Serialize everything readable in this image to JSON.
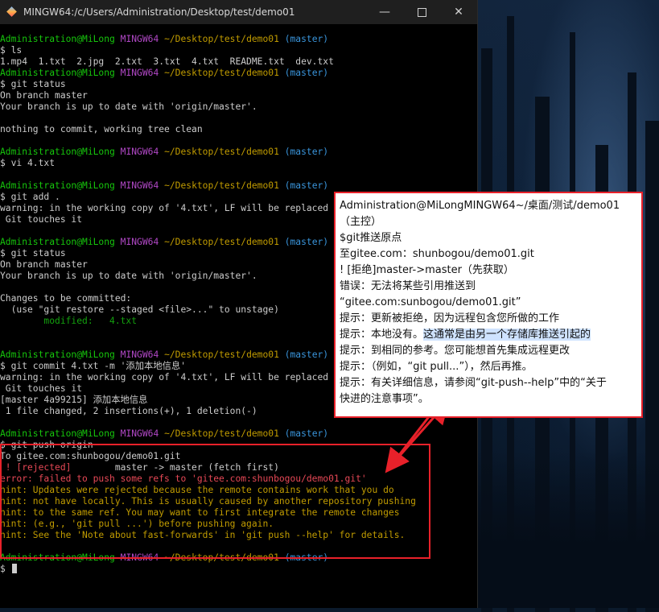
{
  "window": {
    "title": "MINGW64:/c/Users/Administration/Desktop/test/demo01",
    "minimize_glyph": "—",
    "close_glyph": "✕"
  },
  "terminal": {
    "prompt": {
      "user": "Administration@MiLong",
      "shell": "MINGW64",
      "path": "~/Desktop/test/demo01",
      "branch": "(master)"
    },
    "lines": [
      {
        "type": "prompt"
      },
      {
        "type": "cmd",
        "text": "$ ls"
      },
      {
        "type": "out",
        "text": "1.mp4  1.txt  2.jpg  2.txt  3.txt  4.txt  README.txt  dev.txt"
      },
      {
        "type": "prompt"
      },
      {
        "type": "cmd",
        "text": "$ git status"
      },
      {
        "type": "out",
        "text": "On branch master"
      },
      {
        "type": "out",
        "text": "Your branch is up to date with 'origin/master'."
      },
      {
        "type": "blank"
      },
      {
        "type": "out",
        "text": "nothing to commit, working tree clean"
      },
      {
        "type": "blank"
      },
      {
        "type": "prompt"
      },
      {
        "type": "cmd",
        "text": "$ vi 4.txt"
      },
      {
        "type": "blank"
      },
      {
        "type": "prompt"
      },
      {
        "type": "cmd",
        "text": "$ git add ."
      },
      {
        "type": "out",
        "text": "warning: in the working copy of '4.txt', LF will be replaced by CRLF the next time"
      },
      {
        "type": "out",
        "text": " Git touches it"
      },
      {
        "type": "blank"
      },
      {
        "type": "prompt"
      },
      {
        "type": "cmd",
        "text": "$ git status"
      },
      {
        "type": "out",
        "text": "On branch master"
      },
      {
        "type": "out",
        "text": "Your branch is up to date with 'origin/master'."
      },
      {
        "type": "blank"
      },
      {
        "type": "out",
        "text": "Changes to be committed:"
      },
      {
        "type": "out",
        "text": "  (use \"git restore --staged <file>...\" to unstage)"
      },
      {
        "type": "modified",
        "label": "        modified:   ",
        "file": "4.txt"
      },
      {
        "type": "blank"
      },
      {
        "type": "blank"
      },
      {
        "type": "prompt"
      },
      {
        "type": "cmd",
        "text": "$ git commit 4.txt -m '添加本地信息'"
      },
      {
        "type": "out",
        "text": "warning: in the working copy of '4.txt', LF will be replaced by CRLF the next time"
      },
      {
        "type": "out",
        "text": " Git touches it"
      },
      {
        "type": "out",
        "text": "[master 4a99215] 添加本地信息"
      },
      {
        "type": "out",
        "text": " 1 file changed, 2 insertions(+), 1 deletion(-)"
      },
      {
        "type": "blank"
      },
      {
        "type": "prompt"
      },
      {
        "type": "cmd",
        "text": "$ git push origin"
      },
      {
        "type": "out",
        "text": "To gitee.com:shunbogou/demo01.git"
      },
      {
        "type": "rejected",
        "mark": " ! [rejected]",
        "rest": "        master -> master (fetch first)"
      },
      {
        "type": "err",
        "text": "error: failed to push some refs to 'gitee.com:shunbogou/demo01.git'"
      },
      {
        "type": "hint",
        "text": "hint: Updates were rejected because the remote contains work that you do"
      },
      {
        "type": "hint",
        "text": "hint: not have locally. This is usually caused by another repository pushing"
      },
      {
        "type": "hint",
        "text": "hint: to the same ref. You may want to first integrate the remote changes"
      },
      {
        "type": "hint",
        "text": "hint: (e.g., 'git pull ...') before pushing again."
      },
      {
        "type": "hint",
        "text": "hint: See the 'Note about fast-forwards' in 'git push --help' for details."
      },
      {
        "type": "blank"
      },
      {
        "type": "prompt"
      },
      {
        "type": "cursor",
        "text": "$ "
      }
    ]
  },
  "translation": {
    "lines": [
      {
        "text": "Administration@MiLongMINGW64~/桌面/测试/demo01"
      },
      {
        "text": "（主控）"
      },
      {
        "text": "$git推送原点"
      },
      {
        "text": "至gitee.com：shunbogou/demo01.git"
      },
      {
        "text": "! [拒绝]master->master（先获取）"
      },
      {
        "text": "错误：无法将某些引用推送到"
      },
      {
        "text": "“gitee.com:sunbogou/demo01.git”"
      },
      {
        "text": "提示：更新被拒绝，因为远程包含您所做的工作"
      },
      {
        "pre": "提示：本地没有。",
        "hl": "这通常是由另一个存储库推送引起的"
      },
      {
        "text": "提示：到相同的参考。您可能想首先集成远程更改"
      },
      {
        "text": "提示：（例如，“git pull...”），然后再推。"
      },
      {
        "text": "提示：有关详细信息，请参阅“git-push--help”中的“关于"
      },
      {
        "text": "快进的注意事项”。"
      }
    ]
  },
  "colors": {
    "highlight_frame": "#e8212a",
    "prompt_user": "#16c60c",
    "prompt_shell": "#b148c6",
    "prompt_path": "#c19c00",
    "prompt_branch": "#3a96dd",
    "error": "#e74856"
  }
}
